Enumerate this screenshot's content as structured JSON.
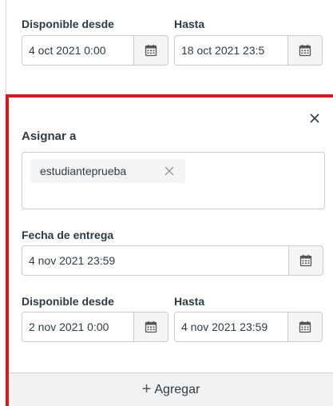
{
  "top_override": {
    "available_from": {
      "label": "Disponible desde",
      "value": "4 oct 2021 0:00"
    },
    "until": {
      "label": "Hasta",
      "value": "18 oct 2021 23:5"
    }
  },
  "override_card": {
    "close_icon": "close-icon",
    "assign_to": {
      "label": "Asignar a",
      "tags": [
        {
          "text": "estudianteprueba"
        }
      ]
    },
    "due_date": {
      "label": "Fecha de entrega",
      "value": "4 nov 2021 23:59"
    },
    "available_from": {
      "label": "Disponible desde",
      "value": "2 nov 2021 0:00"
    },
    "until": {
      "label": "Hasta",
      "value": "4 nov 2021 23:59"
    }
  },
  "add_button": {
    "label": "Agregar"
  },
  "colors": {
    "highlight": "#e0141e",
    "text": "#2d3b45",
    "border": "#c7cdd1"
  },
  "icons": {
    "calendar": "calendar-icon",
    "remove_tag": "close-icon",
    "add": "plus-icon"
  }
}
